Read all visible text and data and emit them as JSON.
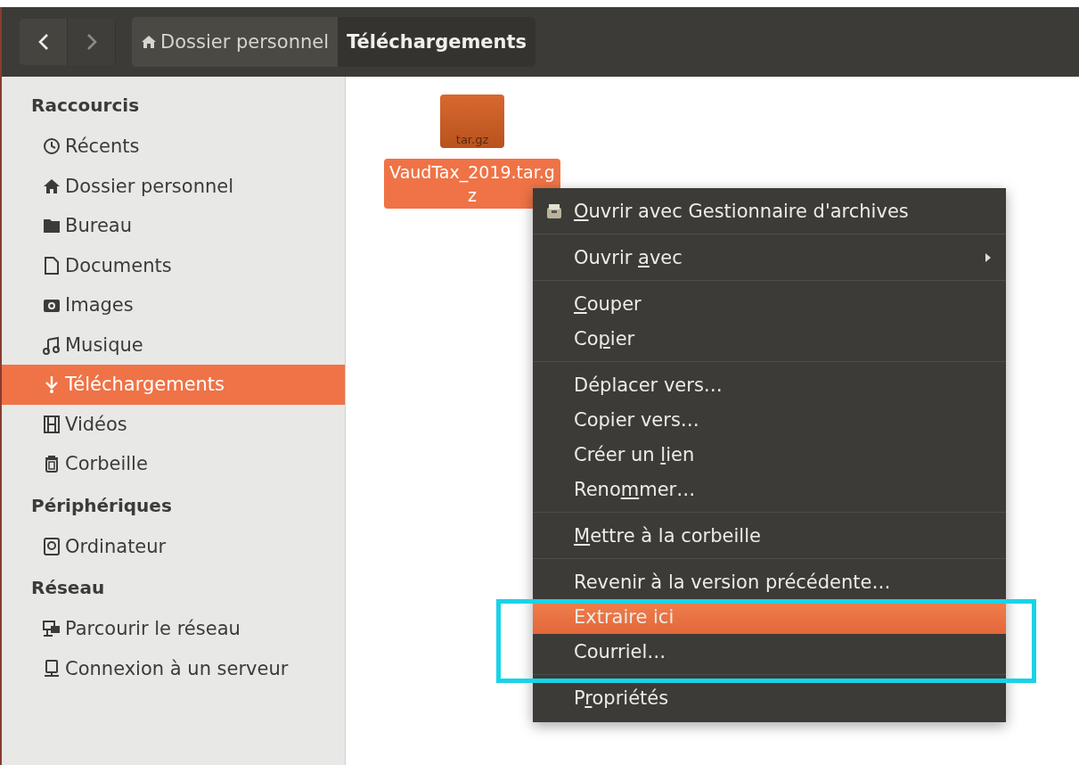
{
  "toolbar": {
    "nav_buttons": [
      {
        "kind": "back",
        "disabled": false
      },
      {
        "kind": "forward",
        "disabled": true
      }
    ],
    "breadcrumbs": [
      {
        "label": "Dossier personnel",
        "kind": "home",
        "selected": false
      },
      {
        "label": "Téléchargements",
        "kind": "folder",
        "selected": true
      }
    ]
  },
  "sidebar": {
    "sections": [
      {
        "title": "Raccourcis",
        "items": [
          {
            "label": "Récents",
            "kind": "clock",
            "selected": false
          },
          {
            "label": "Dossier personnel",
            "kind": "home",
            "selected": false
          },
          {
            "label": "Bureau",
            "kind": "folder",
            "selected": false
          },
          {
            "label": "Documents",
            "kind": "document",
            "selected": false
          },
          {
            "label": "Images",
            "kind": "camera",
            "selected": false
          },
          {
            "label": "Musique",
            "kind": "music",
            "selected": false
          },
          {
            "label": "Téléchargements",
            "kind": "download",
            "selected": true
          },
          {
            "label": "Vidéos",
            "kind": "film",
            "selected": false
          },
          {
            "label": "Corbeille",
            "kind": "trash",
            "selected": false
          }
        ]
      },
      {
        "title": "Périphériques",
        "items": [
          {
            "label": "Ordinateur",
            "kind": "computer",
            "selected": false
          }
        ]
      },
      {
        "title": "Réseau",
        "items": [
          {
            "label": "Parcourir le réseau",
            "kind": "network",
            "selected": false
          },
          {
            "label": "Connexion à un serveur",
            "kind": "server",
            "selected": false
          }
        ]
      }
    ]
  },
  "files": [
    {
      "name": "VaudTax_2019.tar.gz",
      "icon_label": "tar.gz",
      "selected": true
    }
  ],
  "context_menu": {
    "groups": [
      [
        {
          "key": "O",
          "post": "uvrir avec Gestionnaire d'archives",
          "icon": true,
          "selected": false
        }
      ],
      [
        {
          "pre": "Ouvrir ",
          "key": "a",
          "post": "vec",
          "submenu": true,
          "selected": false
        }
      ],
      [
        {
          "key": "C",
          "post": "ouper",
          "selected": false
        },
        {
          "pre": "Co",
          "key": "p",
          "post": "ier",
          "selected": false
        }
      ],
      [
        {
          "pre": "Déplacer vers…",
          "selected": false
        },
        {
          "pre": "Copier vers…",
          "selected": false
        },
        {
          "pre": "Créer un ",
          "key": "l",
          "post": "ien",
          "selected": false
        },
        {
          "pre": "Reno",
          "key": "m",
          "post": "mer…",
          "selected": false
        }
      ],
      [
        {
          "key": "M",
          "post": "ettre à la corbeille",
          "selected": false
        }
      ],
      [
        {
          "pre": "Revenir à la version précédente…",
          "selected": false
        },
        {
          "pre": "Extraire ici",
          "selected": true
        },
        {
          "pre": "Courriel…",
          "selected": false
        }
      ],
      [
        {
          "pre": "P",
          "key": "r",
          "post": "opriétés",
          "selected": false
        }
      ]
    ]
  }
}
